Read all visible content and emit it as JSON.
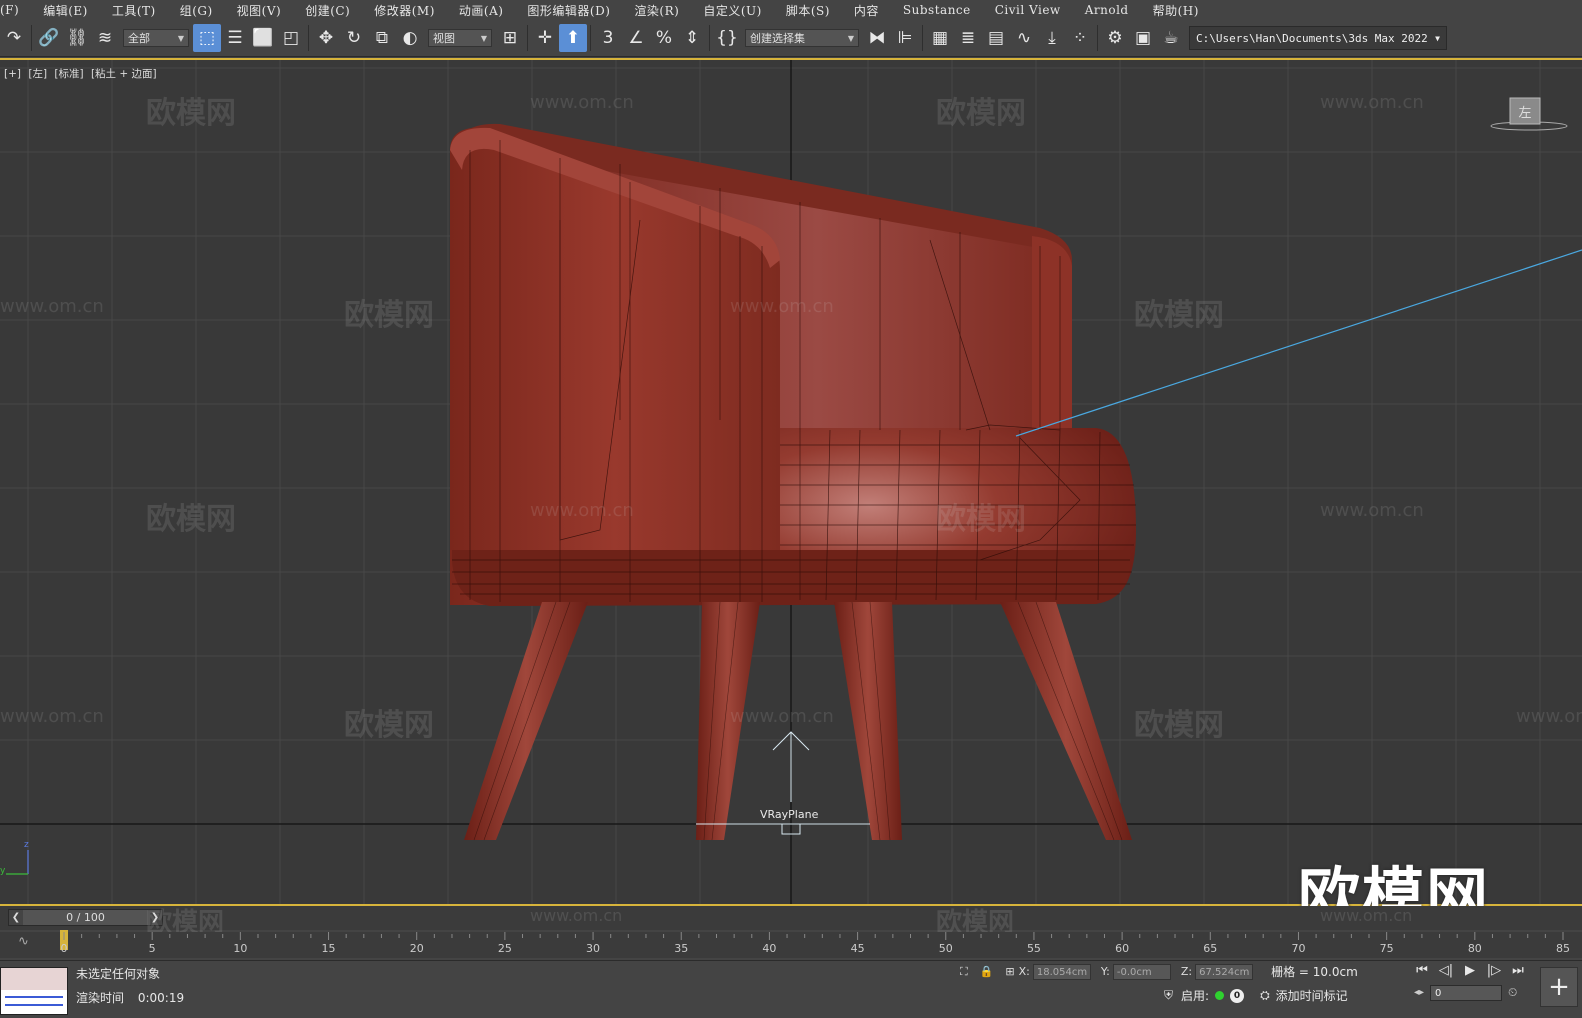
{
  "menu": [
    "(F)",
    "编辑(E)",
    "工具(T)",
    "组(G)",
    "视图(V)",
    "创建(C)",
    "修改器(M)",
    "动画(A)",
    "图形编辑器(D)",
    "渲染(R)",
    "自定义(U)",
    "脚本(S)",
    "内容",
    "Substance",
    "Civil View",
    "Arnold",
    "帮助(H)"
  ],
  "toolbar": {
    "selection_filter": "全部",
    "ref_coord": "视图",
    "named_selection": "创建选择集",
    "project_path": "C:\\Users\\Han\\Documents\\3ds Max 2022",
    "icons": [
      "redo-icon",
      "link-icon",
      "unlink-icon",
      "bind-spacewarp-icon",
      "select-object-icon",
      "select-by-name-icon",
      "rect-region-icon",
      "window-crossing-icon",
      "move-icon",
      "rotate-icon",
      "scale-icon",
      "placement-icon",
      "pivot-icon",
      "snap-toggle-icon",
      "angle-snap-icon",
      "percent-snap-icon",
      "spinner-snap-icon",
      "edit-named-sets-icon",
      "mirror-icon",
      "align-icon",
      "scene-explorer-icon",
      "layer-explorer-icon",
      "ribbon-icon",
      "curve-editor-icon",
      "schematic-icon",
      "material-editor-icon",
      "render-setup-icon",
      "rendered-frame-icon",
      "render-production-icon"
    ]
  },
  "viewport": {
    "label": [
      "[+]",
      "[左]",
      "[标准]",
      "[粘土 + 边面]"
    ],
    "viewcube_face": "左",
    "object_label": "VRayPlane",
    "axis_z": "z",
    "axis_y": "y",
    "watermark_cn": "欧模网",
    "watermark_url": "www.om.cn",
    "logo": "欧模网",
    "colors": {
      "chair": "#8b2e22",
      "grid": "#4a4a4a",
      "selection_border": "#d7b43b",
      "light_line": "#4aa8e0"
    }
  },
  "timeline": {
    "frame_display": "0 / 100",
    "ticks": [
      "0",
      "5",
      "10",
      "15",
      "20",
      "25",
      "30",
      "35",
      "40",
      "45",
      "50",
      "55",
      "60",
      "65",
      "70",
      "75",
      "80",
      "85"
    ]
  },
  "status": {
    "message": "未选定任何对象",
    "render_time_label": "渲染时间",
    "render_time_value": "0:00:19",
    "x_label": "X:",
    "x_value": "18.054cm",
    "y_label": "Y:",
    "y_value": "-0.0cm",
    "z_label": "Z:",
    "z_value": "67.524cm",
    "grid": "栅格 = 10.0cm",
    "enable_label": "启用:",
    "enable_count": "0",
    "add_time_tag": "添加时间标记",
    "current_frame": "0"
  }
}
